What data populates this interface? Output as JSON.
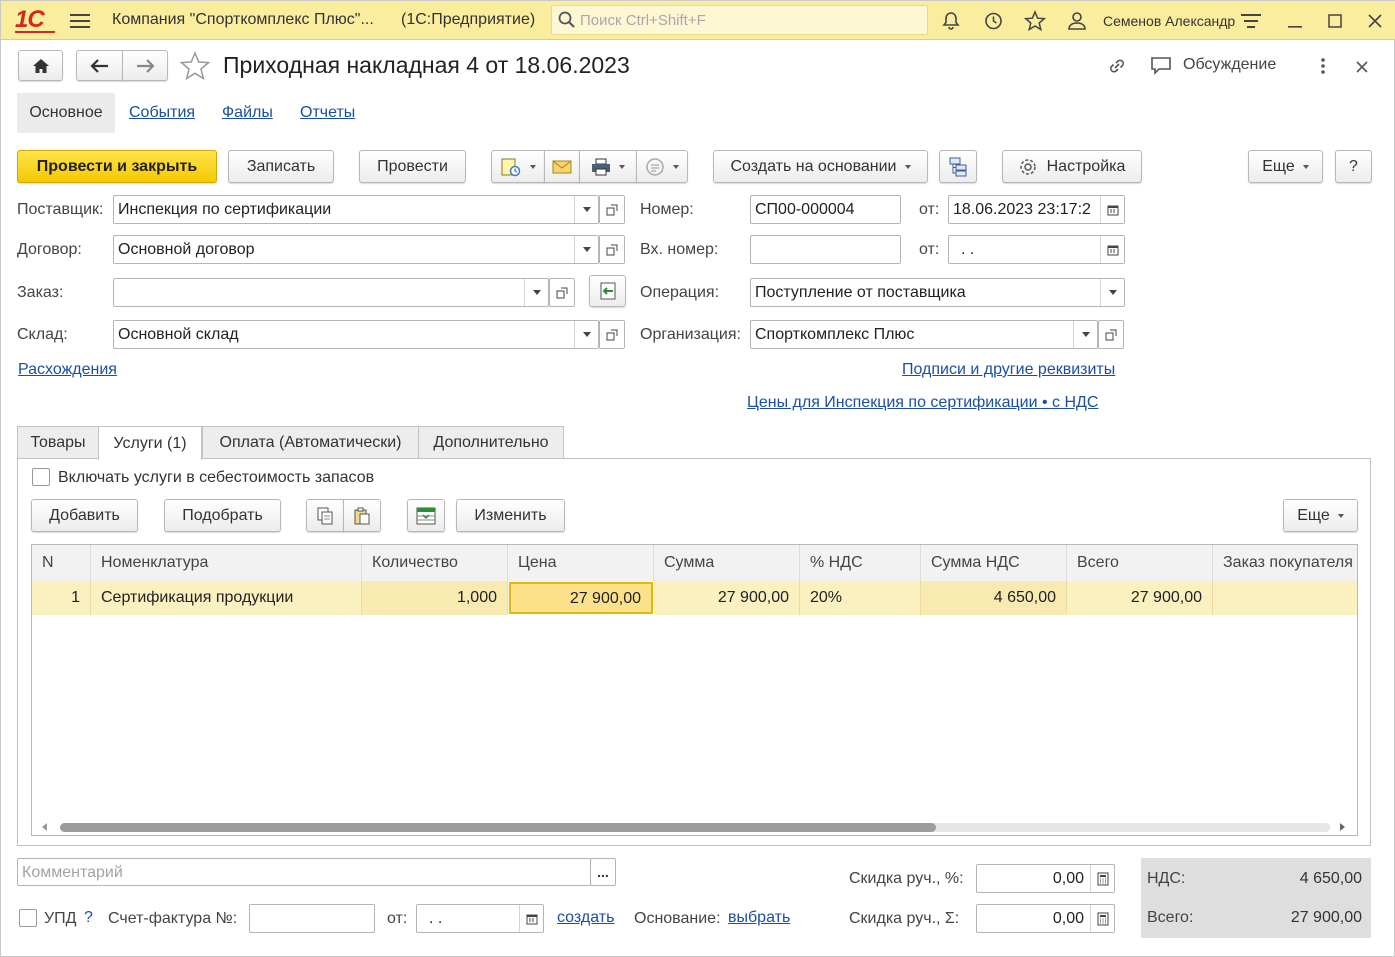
{
  "topbar": {
    "logo": "1С",
    "company": "Компания \"Спорткомплекс Плюс\"...",
    "app": "(1С:Предприятие)",
    "search_placeholder": "Поиск Ctrl+Shift+F",
    "user": "Семенов Александр"
  },
  "header": {
    "title": "Приходная накладная 4 от 18.06.2023",
    "discussion": "Обсуждение"
  },
  "nav_tabs": [
    "Основное",
    "События",
    "Файлы",
    "Отчеты"
  ],
  "toolbar": {
    "post_close": "Провести и закрыть",
    "save": "Записать",
    "post": "Провести",
    "create_based": "Создать на основании",
    "settings": "Настройка",
    "more": "Еще",
    "help": "?"
  },
  "form": {
    "supplier_label": "Поставщик:",
    "supplier": "Инспекция по сертификации",
    "contract_label": "Договор:",
    "contract": "Основной договор",
    "order_label": "Заказ:",
    "order": "",
    "warehouse_label": "Склад:",
    "warehouse": "Основной склад",
    "number_label": "Номер:",
    "number": "СП00-000004",
    "date_label": "от:",
    "date": "18.06.2023 23:17:2",
    "in_number_label": "Вх. номер:",
    "in_number": "",
    "in_date_label": "от:",
    "in_date": " .  .",
    "operation_label": "Операция:",
    "operation": "Поступление от поставщика",
    "org_label": "Организация:",
    "org": "Спорткомплекс Плюс",
    "discrepancies": "Расхождения",
    "signatures": "Подписи и другие реквизиты",
    "prices": "Цены для Инспекция по сертификации • с НДС"
  },
  "tabs": [
    "Товары",
    "Услуги (1)",
    "Оплата (Автоматически)",
    "Дополнительно"
  ],
  "services": {
    "include_label": "Включать услуги в себестоимость запасов",
    "add": "Добавить",
    "pick": "Подобрать",
    "change": "Изменить",
    "more": "Еще",
    "columns": [
      "N",
      "Номенклатура",
      "Количество",
      "Цена",
      "Сумма",
      "% НДС",
      "Сумма НДС",
      "Всего",
      "Заказ покупателя"
    ],
    "rows": [
      {
        "n": "1",
        "item": "Сертификация продукции",
        "qty": "1,000",
        "price": "27 900,00",
        "sum": "27 900,00",
        "vat_rate": "20%",
        "vat_sum": "4 650,00",
        "total": "27 900,00",
        "order": ""
      }
    ]
  },
  "footer": {
    "comment_placeholder": "Комментарий",
    "comment_btn": "...",
    "upd_label": "УПД",
    "upd_help": "?",
    "invoice_label": "Счет-фактура №:",
    "invoice_date_label": "от:",
    "invoice_date": " .  .",
    "create_link": "создать",
    "basis_label": "Основание:",
    "basis_link": "выбрать",
    "discount_pct_label": "Скидка руч., %:",
    "discount_pct": "0,00",
    "discount_sum_label": "Скидка руч., Σ:",
    "discount_sum": "0,00",
    "vat_label": "НДС:",
    "vat": "4 650,00",
    "total_label": "Всего:",
    "total": "27 900,00"
  },
  "colors": {
    "topbar": "#fbed9e",
    "primary_button": "#f5c800",
    "link": "#1b4fa3",
    "row_highlight": "#fbf0c0"
  }
}
